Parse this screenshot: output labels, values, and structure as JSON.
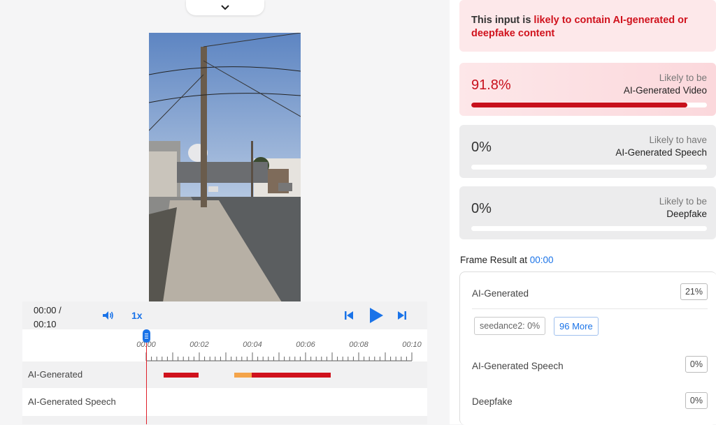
{
  "player": {
    "time_current": "00:00 /",
    "time_total": "00:10",
    "speed": "1x",
    "ticks": [
      "00:00",
      "00:02",
      "00:04",
      "00:06",
      "00:08",
      "00:10"
    ],
    "duration_s": 10,
    "playhead_s": 0,
    "tracks": [
      {
        "label": "AI-Generated",
        "segments": [
          {
            "start": 0.66,
            "end": 1.98,
            "color": "#d0121d"
          },
          {
            "start": 3.32,
            "end": 3.98,
            "color": "#f4a44a"
          },
          {
            "start": 3.98,
            "end": 6.95,
            "color": "#d0121d"
          }
        ]
      },
      {
        "label": "AI-Generated Speech",
        "segments": []
      }
    ]
  },
  "result": {
    "warning_prefix": "This input is ",
    "warning_highlight": "likely to contain AI-generated or deepfake content",
    "cards": [
      {
        "pct": "91.8%",
        "value": 0.918,
        "line1": "Likely to be",
        "line2": "AI-Generated Video",
        "style": "red"
      },
      {
        "pct": "0%",
        "value": 0,
        "line1": "Likely to have",
        "line2": "AI-Generated Speech",
        "style": "gray"
      },
      {
        "pct": "0%",
        "value": 0,
        "line1": "Likely to be",
        "line2": "Deepfake",
        "style": "gray"
      }
    ]
  },
  "frame": {
    "title": "Frame Result at ",
    "time": "00:00",
    "ai_generated_label": "AI-Generated",
    "ai_generated_pct": "21%",
    "chip_model": "seedance2: 0%",
    "chip_more": "96 More",
    "speech_label": "AI-Generated Speech",
    "speech_pct": "0%",
    "deepfake_label": "Deepfake",
    "deepfake_pct": "0%"
  },
  "colors": {
    "accent": "#1a73e8",
    "danger": "#d0121d",
    "warn_orange": "#f4a44a"
  }
}
